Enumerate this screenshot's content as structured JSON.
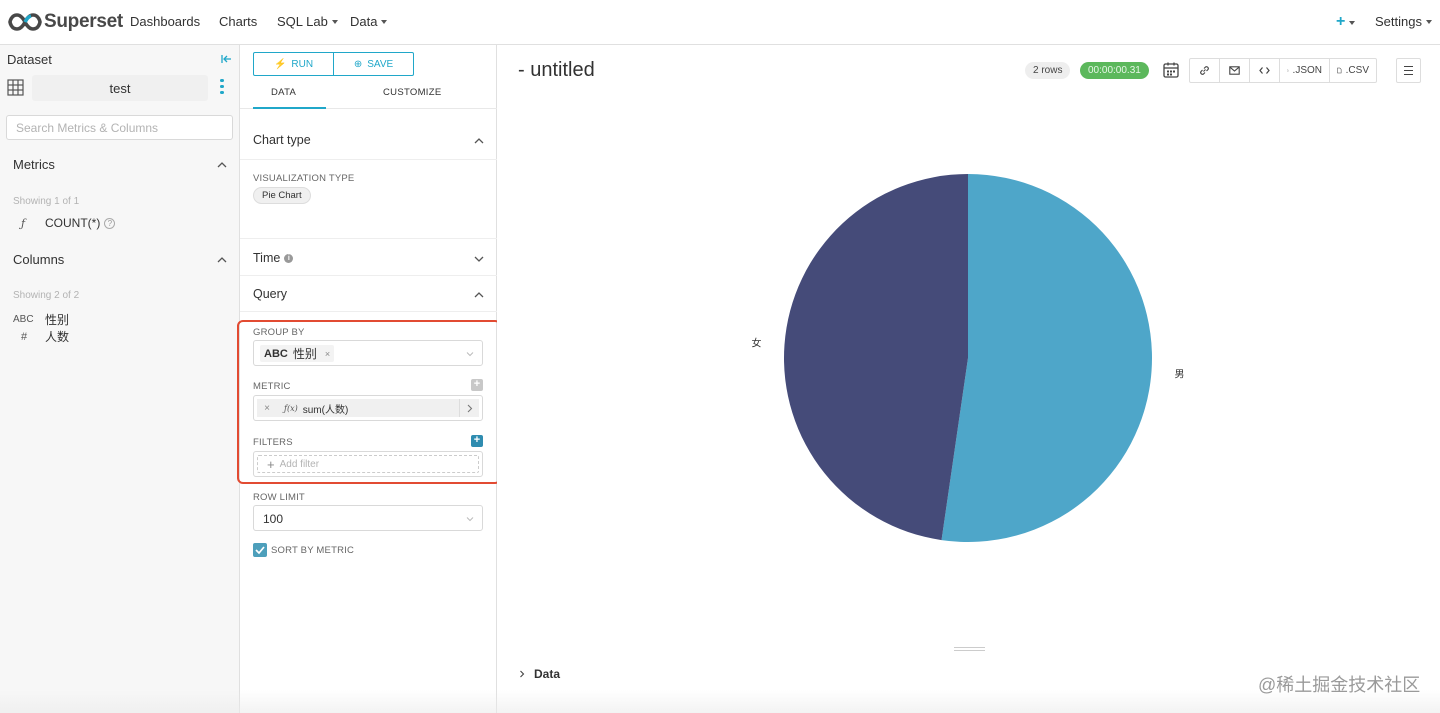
{
  "navbar": {
    "brand": "Superset",
    "links": [
      {
        "label": "Dashboards"
      },
      {
        "label": "Charts"
      },
      {
        "label": "SQL Lab"
      },
      {
        "label": "Data"
      }
    ],
    "plus_label": "+",
    "settings": "Settings",
    "accent": "#20a7c9"
  },
  "datasource": {
    "title": "Dataset",
    "name": "test",
    "search_placeholder": "Search Metrics & Columns",
    "metrics_title": "Metrics",
    "metrics_showing": "Showing 1 of 1",
    "metrics": [
      {
        "type": "ƒ",
        "name": "COUNT(*)"
      }
    ],
    "columns_title": "Columns",
    "columns_showing": "Showing 2 of 2",
    "columns": [
      {
        "type": "ABC",
        "name": "性别"
      },
      {
        "type": "#",
        "name": "人数"
      }
    ]
  },
  "controls": {
    "run_label": "RUN",
    "save_label": "SAVE",
    "tabs": [
      "DATA",
      "CUSTOMIZE"
    ],
    "chart_type_title": "Chart type",
    "viz_type_label": "VISUALIZATION TYPE",
    "viz_type_value": "Pie Chart",
    "time_title": "Time",
    "query_title": "Query",
    "group_by_label": "GROUP BY",
    "group_by_tag_type": "ABC",
    "group_by_tag_value": "性别",
    "metric_label": "METRIC",
    "metric_fx": "ƒ(x)",
    "metric_value": "sum(人数)",
    "filters_label": "FILTERS",
    "add_filter": "Add filter",
    "row_limit_label": "ROW LIMIT",
    "row_limit_value": "100",
    "sort_by_metric_label": "SORT BY METRIC",
    "sort_by_metric_checked": true
  },
  "main": {
    "title": "- untitled",
    "rows_badge": "2 rows",
    "time_badge": "00:00:00.31",
    "json_label": ".JSON",
    "csv_label": ".CSV",
    "data_section": "Data"
  },
  "chart_data": {
    "type": "pie",
    "categories": [
      "男",
      "女"
    ],
    "values": [
      52.3,
      47.7
    ],
    "colors": [
      "#4ea6c9",
      "#454b79"
    ]
  },
  "watermark": "@稀土掘金技术社区"
}
